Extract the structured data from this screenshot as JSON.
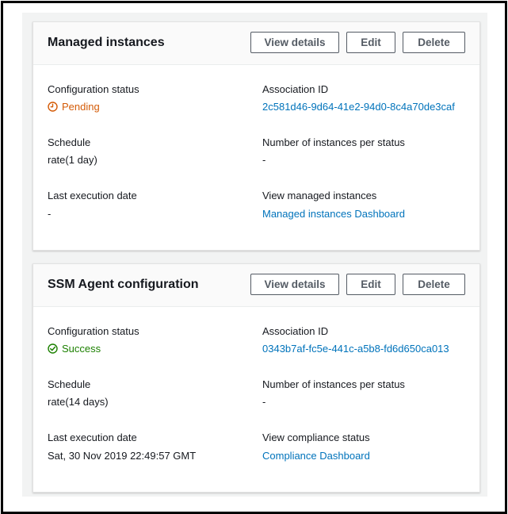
{
  "colors": {
    "link": "#0073bb",
    "pending": "#d45b07",
    "success": "#1d8102",
    "text": "#16191f"
  },
  "cards": [
    {
      "title": "Managed instances",
      "buttons": {
        "view_details": "View details",
        "edit": "Edit",
        "delete": "Delete"
      },
      "configuration_status": {
        "label": "Configuration status",
        "value": "Pending",
        "icon": "clock-icon"
      },
      "association_id": {
        "label": "Association ID",
        "value": "2c581d46-9d64-41e2-94d0-8c4a70de3caf"
      },
      "schedule": {
        "label": "Schedule",
        "value": "rate(1 day)"
      },
      "instances_per_status": {
        "label": "Number of instances per status",
        "value": "-"
      },
      "last_execution": {
        "label": "Last execution date",
        "value": "-"
      },
      "view_link": {
        "label": "View managed instances",
        "value": "Managed instances Dashboard"
      }
    },
    {
      "title": "SSM Agent configuration",
      "buttons": {
        "view_details": "View details",
        "edit": "Edit",
        "delete": "Delete"
      },
      "configuration_status": {
        "label": "Configuration status",
        "value": "Success",
        "icon": "check-circle-icon"
      },
      "association_id": {
        "label": "Association ID",
        "value": "0343b7af-fc5e-441c-a5b8-fd6d650ca013"
      },
      "schedule": {
        "label": "Schedule",
        "value": "rate(14 days)"
      },
      "instances_per_status": {
        "label": "Number of instances per status",
        "value": "-"
      },
      "last_execution": {
        "label": "Last execution date",
        "value": "Sat, 30 Nov 2019 22:49:57 GMT"
      },
      "view_link": {
        "label": "View compliance status",
        "value": "Compliance Dashboard"
      }
    }
  ]
}
